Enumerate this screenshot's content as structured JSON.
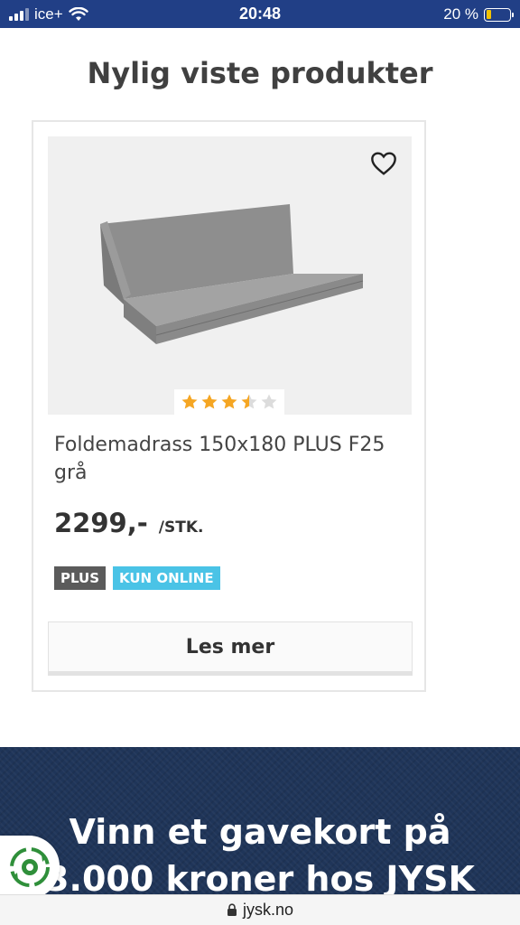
{
  "status_bar": {
    "carrier": "ice+",
    "time": "20:48",
    "battery": "20 %",
    "battery_level": 0.2
  },
  "section": {
    "title": "Nylig viste produkter"
  },
  "product": {
    "title": "Foldemadrass 150x180 PLUS F25 grå",
    "price": "2299,-",
    "unit": "/STK.",
    "rating": 3.5,
    "rating_max": 5,
    "badges": [
      "PLUS",
      "KUN ONLINE"
    ],
    "button_label": "Les mer",
    "icons": {
      "favorite": "heart-icon",
      "star": "star-icon"
    },
    "colors": {
      "star": "#f5a623",
      "plus_badge": "#5b5b5b",
      "online_badge": "#4ac3e6"
    }
  },
  "banner": {
    "line1": "Vinn et gavekort på",
    "line2": "3.000 kroner hos JYSK"
  },
  "browser": {
    "url": "jysk.no"
  }
}
